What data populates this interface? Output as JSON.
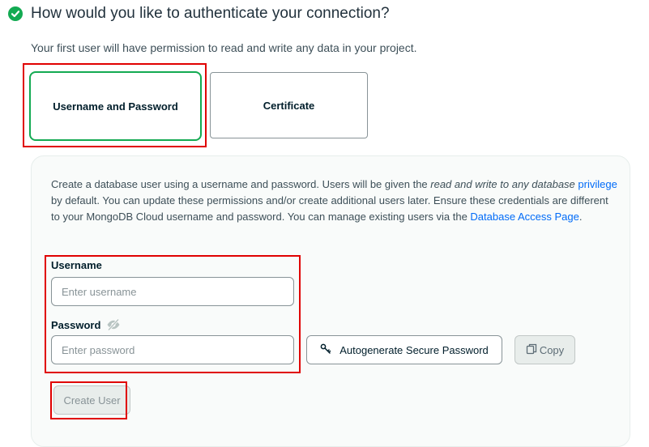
{
  "header": {
    "title": "How would you like to authenticate your connection?",
    "subtitle": "Your first user will have permission to read and write any data in your project."
  },
  "auth_methods": [
    {
      "label": "Username and Password",
      "selected": true
    },
    {
      "label": "Certificate",
      "selected": false
    }
  ],
  "panel": {
    "description": {
      "part1": "Create a database user using a username and password. Users will be given the ",
      "italic": "read and write to any database",
      "link1": "privilege",
      "part2": " by default. You can update these permissions and/or create additional users later. Ensure these credentials are different to your MongoDB Cloud username and password. You can manage existing users via the ",
      "link2": "Database Access Page",
      "part3": "."
    },
    "username": {
      "label": "Username",
      "placeholder": "Enter username",
      "value": ""
    },
    "password": {
      "label": "Password",
      "placeholder": "Enter password",
      "value": ""
    },
    "autogenerate_label": "Autogenerate Secure Password",
    "copy_label": "Copy",
    "create_user_label": "Create User"
  },
  "colors": {
    "accent_green": "#13aa52",
    "annotation_red": "#e00000",
    "link_blue": "#016bf8"
  },
  "icons": {
    "header": "check-circle-icon",
    "password_visibility": "eye-off-icon",
    "autogenerate": "key-icon",
    "copy": "copy-icon"
  }
}
